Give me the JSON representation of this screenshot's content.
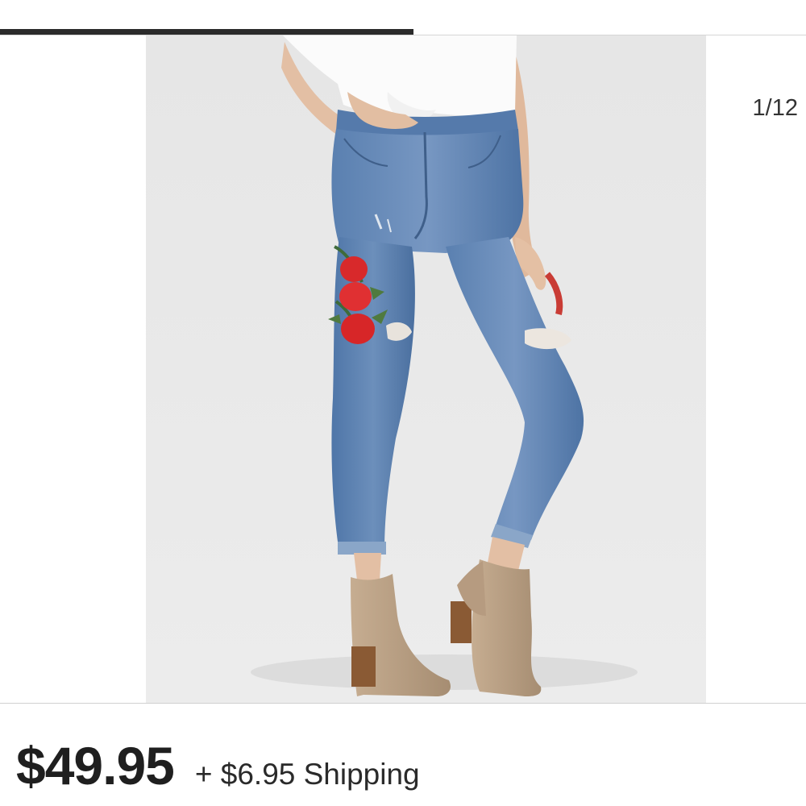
{
  "gallery": {
    "counter": "1/12",
    "image_subject": "Woman wearing light-wash cropped jeans with red rose embroidery, white knotted top and tan suede ankle boots"
  },
  "listing": {
    "price": "$49.95",
    "shipping": "+ $6.95 Shipping"
  },
  "colors": {
    "tab_indicator": "#2b2b2b",
    "photo_background": "#e9e9e9",
    "denim": "#5b7fae",
    "embroidery": "#d8292b",
    "boots": "#b89f83"
  }
}
